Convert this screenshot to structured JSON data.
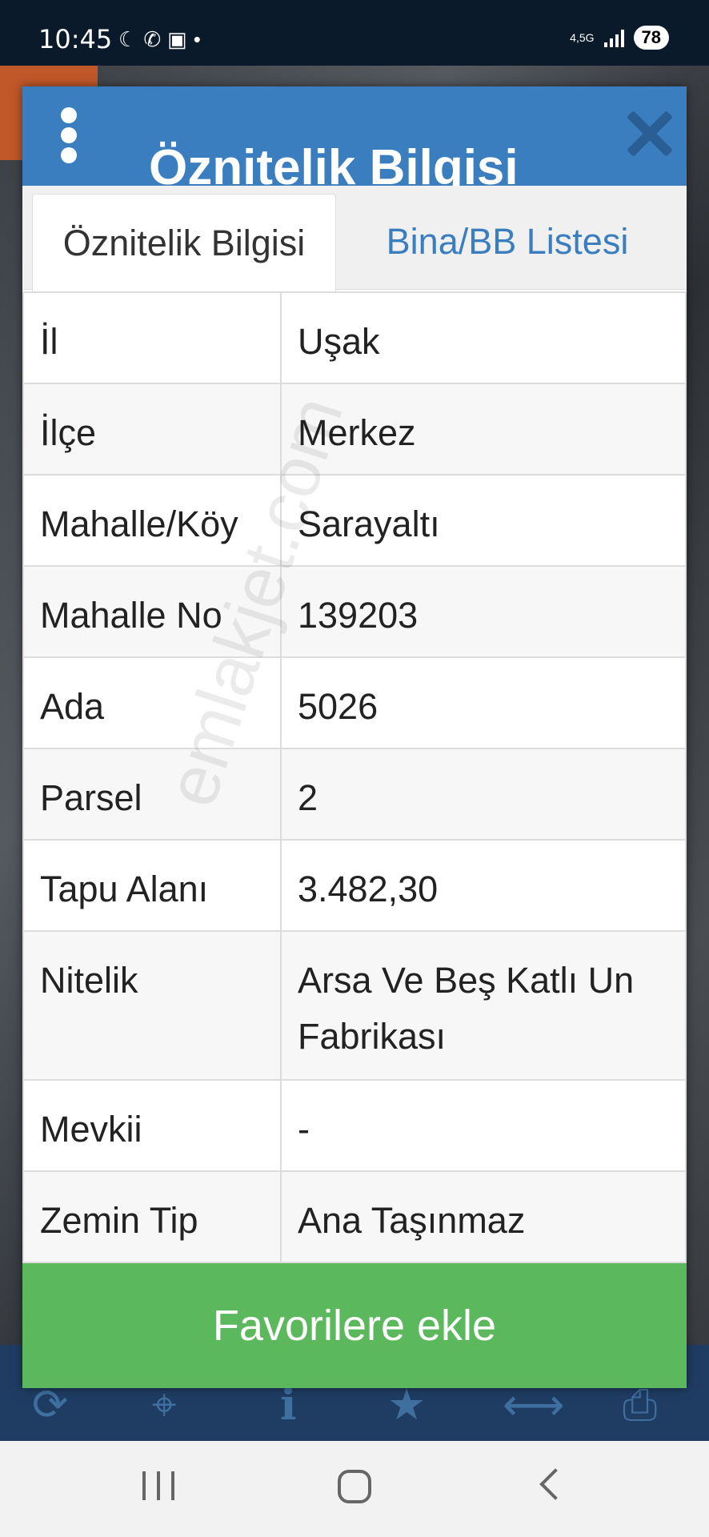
{
  "status_bar": {
    "time": "10:45",
    "notification_icons": [
      "moon-icon",
      "whatsapp-icon",
      "screenshot-icon",
      "dot-icon"
    ],
    "network": "4,5G",
    "battery": "78"
  },
  "map_toolbar": {
    "icons": [
      "refresh-icon",
      "locate-icon",
      "info-icon",
      "favorite-star-icon",
      "measure-icon",
      "print-icon"
    ]
  },
  "dialog": {
    "title": "Öznitelik Bilgisi",
    "tabs": [
      {
        "label": "Öznitelik Bilgisi",
        "active": true
      },
      {
        "label": "Bina/BB Listesi",
        "active": false
      }
    ],
    "rows": [
      {
        "key": "İl",
        "value": "Uşak"
      },
      {
        "key": "İlçe",
        "value": "Merkez"
      },
      {
        "key": "Mahalle/Köy",
        "value": "Sarayaltı"
      },
      {
        "key": "Mahalle No",
        "value": "139203"
      },
      {
        "key": "Ada",
        "value": "5026"
      },
      {
        "key": "Parsel",
        "value": "2"
      },
      {
        "key": "Tapu Alanı",
        "value": "3.482,30"
      },
      {
        "key": "Nitelik",
        "value": "Arsa Ve Beş Katlı Un Fabrikası"
      },
      {
        "key": "Mevkii",
        "value": "-"
      },
      {
        "key": "Zemin Tip",
        "value": "Ana Taşınmaz"
      }
    ],
    "favorite_button": "Favorilere ekle"
  },
  "watermark": "emlakjet.com",
  "colors": {
    "header_blue": "#3a7ebf",
    "tab_link_blue": "#3a7ebf",
    "button_green": "#5cb85c",
    "status_bar_bg": "#0b1a2b"
  }
}
